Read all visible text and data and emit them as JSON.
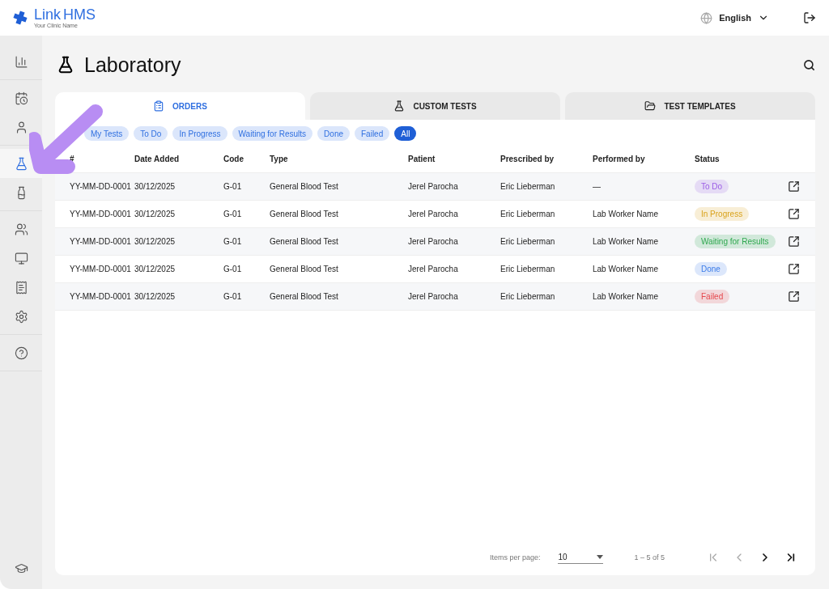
{
  "brand": {
    "name": "Link",
    "name_bold": "HMS",
    "subtitle": "Your Clinic Name"
  },
  "header": {
    "language": "English"
  },
  "sidebar": {
    "groups": [
      [
        {
          "kind": "dashboard",
          "selected": false
        }
      ],
      [
        {
          "kind": "calendar",
          "selected": false
        },
        {
          "kind": "user",
          "selected": false
        }
      ],
      [
        {
          "kind": "lab",
          "selected": true
        },
        {
          "kind": "bottle",
          "selected": false
        }
      ],
      [
        {
          "kind": "users",
          "selected": false
        },
        {
          "kind": "monitor",
          "selected": false
        },
        {
          "kind": "invoice",
          "selected": false
        },
        {
          "kind": "settings",
          "selected": false
        }
      ],
      [
        {
          "kind": "help",
          "selected": false
        }
      ]
    ],
    "bottom": {
      "kind": "academy",
      "selected": false
    }
  },
  "page": {
    "title": "Laboratory"
  },
  "tabs": [
    {
      "label": "ORDERS",
      "kind": "clipboard",
      "selected": true
    },
    {
      "label": "CUSTOM TESTS",
      "kind": "flask",
      "selected": false
    },
    {
      "label": "TEST TEMPLATES",
      "kind": "folder",
      "selected": false
    }
  ],
  "filters": [
    {
      "label": "My Tests",
      "selected": false
    },
    {
      "label": "To Do",
      "selected": false
    },
    {
      "label": "In Progress",
      "selected": false
    },
    {
      "label": "Waiting for Results",
      "selected": false
    },
    {
      "label": "Done",
      "selected": false
    },
    {
      "label": "Failed",
      "selected": false
    },
    {
      "label": "All",
      "selected": true
    }
  ],
  "table": {
    "columns": [
      "#",
      "Date Added",
      "Code",
      "Type",
      "Patient",
      "Prescribed by",
      "Performed by",
      "Status"
    ],
    "rows": [
      {
        "id": "YY-MM-DD-0001",
        "date": "30/12/2025",
        "code": "G-01",
        "type": "General Blood Test",
        "patient": "Jerel Parocha",
        "prescribed_by": "Eric Lieberman",
        "performed_by": "—",
        "status": "To Do",
        "color": "#9b5de5"
      },
      {
        "id": "YY-MM-DD-0001",
        "date": "30/12/2025",
        "code": "G-01",
        "type": "General Blood Test",
        "patient": "Jerel Parocha",
        "prescribed_by": "Eric Lieberman",
        "performed_by": "Lab Worker Name",
        "status": "In Progress",
        "color": "#d9a21b"
      },
      {
        "id": "YY-MM-DD-0001",
        "date": "30/12/2025",
        "code": "G-01",
        "type": "General Blood Test",
        "patient": "Jerel Parocha",
        "prescribed_by": "Eric Lieberman",
        "performed_by": "Lab Worker Name",
        "status": "Waiting for Results",
        "color": "#2fa84f"
      },
      {
        "id": "YY-MM-DD-0001",
        "date": "30/12/2025",
        "code": "G-01",
        "type": "General Blood Test",
        "patient": "Jerel Parocha",
        "prescribed_by": "Eric Lieberman",
        "performed_by": "Lab Worker Name",
        "status": "Done",
        "color": "#3b7be8"
      },
      {
        "id": "YY-MM-DD-0001",
        "date": "30/12/2025",
        "code": "G-01",
        "type": "General Blood Test",
        "patient": "Jerel Parocha",
        "prescribed_by": "Eric Lieberman",
        "performed_by": "Lab Worker Name",
        "status": "Failed",
        "color": "#e5484d"
      }
    ]
  },
  "pagination": {
    "label": "Items per page:",
    "page_size": "10",
    "range": "1 – 5 of 5",
    "first_disabled": true,
    "prev_disabled": true,
    "next_disabled": false,
    "last_disabled": false
  }
}
